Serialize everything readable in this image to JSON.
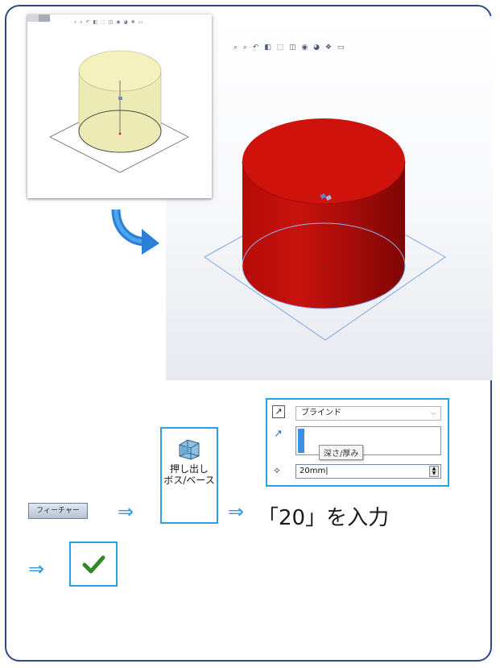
{
  "viewport": {
    "toolbar_icons": [
      "zoom-to-fit-icon",
      "zoom-area-icon",
      "previous-view-icon",
      "section-view-icon",
      "view-orientation-icon",
      "display-style-icon",
      "hide-show-icon",
      "edit-appearance-icon",
      "apply-scene-icon",
      "view-settings-icon"
    ],
    "model_color": "#c8120d"
  },
  "thumbnail": {
    "model_color": "#f3efb4"
  },
  "toolbar": {
    "feature_tab_label": "フィーチャー"
  },
  "extrude_command": {
    "label_line1": "押し出し",
    "label_line2": "ボス/ベース"
  },
  "instruction": {
    "arrow": "⇒",
    "input_text": "「20」を入力"
  },
  "property_manager": {
    "end_condition": "ブラインド",
    "depth_tooltip": "深さ/厚み",
    "depth_value": "20mm"
  },
  "colors": {
    "accent": "#2aa0e0",
    "frame": "#2b4a87"
  }
}
